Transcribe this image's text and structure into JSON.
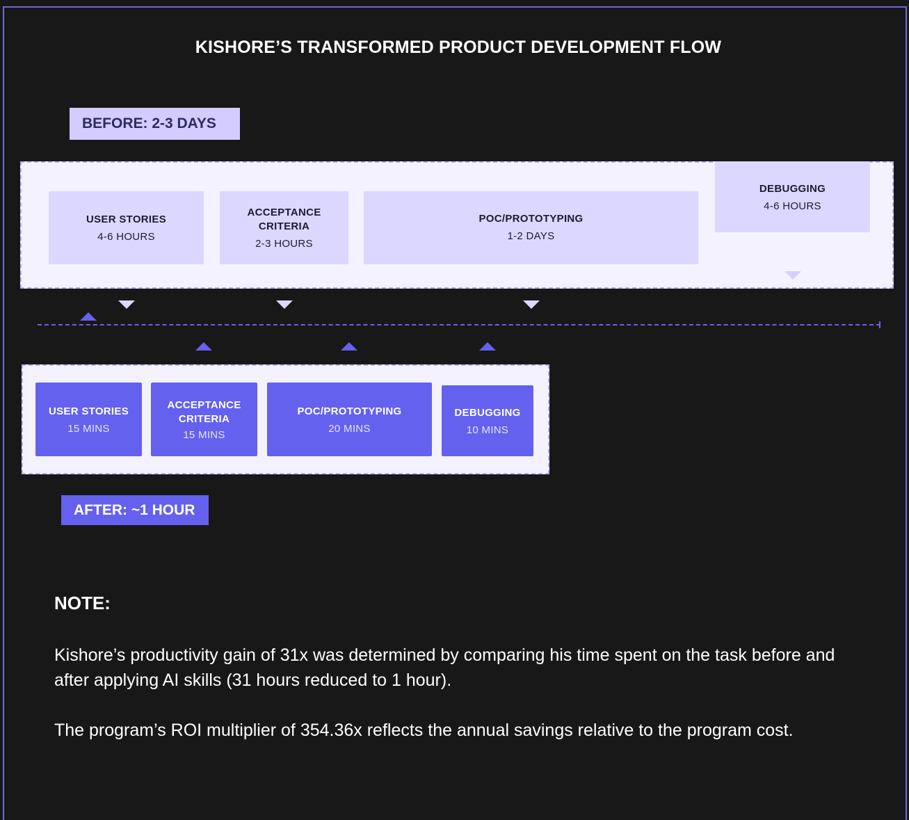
{
  "title": "KISHORE’S TRANSFORMED PRODUCT DEVELOPMENT FLOW",
  "before": {
    "tag": "BEFORE: 2-3 DAYS",
    "steps": [
      {
        "label": "USER STORIES",
        "duration": "4-6 HOURS"
      },
      {
        "label": "ACCEPTANCE\nCRITERIA",
        "duration": "2-3 HOURS"
      },
      {
        "label": "POC/PROTOTYPING",
        "duration": "1-2 DAYS"
      },
      {
        "label": "DEBUGGING",
        "duration": "4-6 HOURS"
      }
    ]
  },
  "after": {
    "tag": "AFTER: ~1 HOUR",
    "steps": [
      {
        "label": "USER STORIES",
        "duration": "15 MINS"
      },
      {
        "label": "ACCEPTANCE\nCRITERIA",
        "duration": "15 MINS"
      },
      {
        "label": "POC/PROTOTYPING",
        "duration": "20 MINS"
      },
      {
        "label": "DEBUGGING",
        "duration": "10 MINS"
      }
    ]
  },
  "note": {
    "heading": "NOTE:",
    "paragraph1": "Kishore’s productivity gain of 31x was determined by comparing his time spent on the task before and after applying AI skills (31 hours reduced to 1 hour).",
    "paragraph2": "The program’s ROI multiplier of 354.36x reflects the annual savings relative to the program cost."
  },
  "colors": {
    "background": "#181818",
    "before_panel": "#f4f2ff",
    "before_box": "#dcd7ff",
    "after_box": "#6461ee",
    "timeline": "#7a5be8"
  }
}
